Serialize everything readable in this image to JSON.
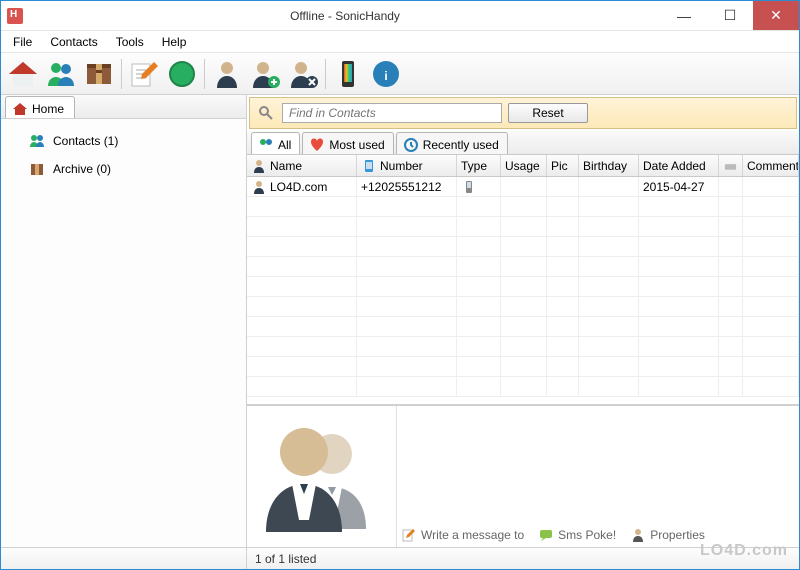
{
  "window": {
    "title": "Offline - SonicHandy"
  },
  "menu": {
    "file": "File",
    "contacts": "Contacts",
    "tools": "Tools",
    "help": "Help"
  },
  "sidebar": {
    "home_tab": "Home",
    "items": [
      {
        "label": "Contacts (1)"
      },
      {
        "label": "Archive (0)"
      }
    ]
  },
  "search": {
    "placeholder": "Find in Contacts",
    "reset": "Reset"
  },
  "filter_tabs": {
    "all": "All",
    "most_used": "Most used",
    "recently_used": "Recently used"
  },
  "columns": {
    "name": "Name",
    "number": "Number",
    "type": "Type",
    "usage": "Usage",
    "pic": "Pic",
    "birthday": "Birthday",
    "date_added": "Date Added",
    "comment": "Comment"
  },
  "rows": [
    {
      "name": "LO4D.com",
      "number": "+12025551212",
      "type": "",
      "usage": "",
      "pic": "",
      "birthday": "",
      "date_added": "2015-04-27",
      "comment": ""
    }
  ],
  "actions": {
    "write": "Write a message to",
    "sms_poke": "Sms Poke!",
    "properties": "Properties"
  },
  "status": {
    "text": "1 of 1 listed"
  },
  "watermark": "LO4D.com"
}
